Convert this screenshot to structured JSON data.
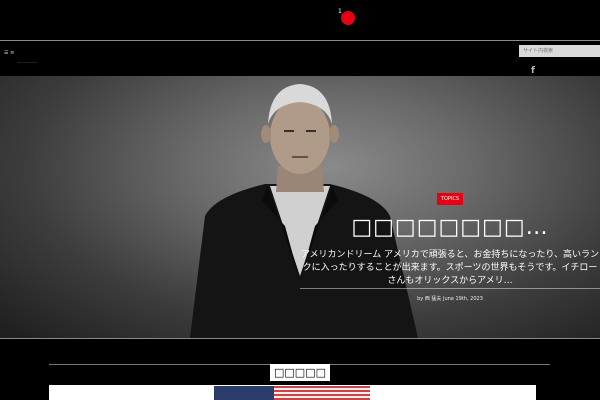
{
  "header": {
    "logo_tick": "1",
    "menu_label": "☰ ≡",
    "menu_sub": "————",
    "search_placeholder": "サイト内検索",
    "social_icon": "facebook-icon",
    "social_glyph": "f"
  },
  "hero": {
    "badge": "TOPICS",
    "headline": "□□□□□□□□…",
    "excerpt": "アメリカンドリーム アメリカで頑張ると、お金持ちになったり、高いランクに入ったりすることが出来ます。スポーツの世界もそうです。イチローさんもオリックスからアメリ…",
    "byline": "by 西 猛夫 June 19th, 2023"
  },
  "section": {
    "title": "□□□□□"
  },
  "colors": {
    "accent": "#e60012",
    "background": "#000000"
  }
}
